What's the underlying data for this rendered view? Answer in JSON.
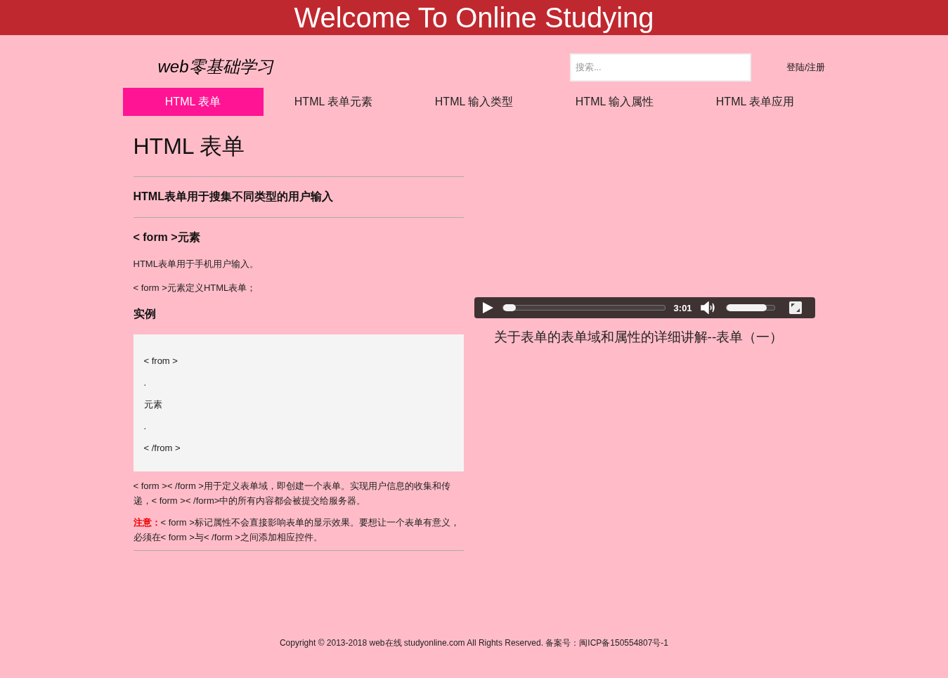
{
  "banner": {
    "title": "Welcome To Online Studying"
  },
  "header": {
    "logo": "web零基础学习",
    "search": {
      "placeholder": "搜索..."
    },
    "login": "登陆/注册"
  },
  "tabs": [
    {
      "label": "HTML 表单",
      "selected": true
    },
    {
      "label": "HTML 表单元素",
      "selected": false
    },
    {
      "label": "HTML 输入类型",
      "selected": false
    },
    {
      "label": "HTML 输入属性",
      "selected": false
    },
    {
      "label": "HTML 表单应用",
      "selected": false
    }
  ],
  "article": {
    "title": "HTML 表单",
    "subtitle": "HTML表单用于搜集不同类型的用户输入",
    "section": "< form >元素",
    "paragraphs": [
      "HTML表单用于手机用户输入。",
      "< form >元素定义HTML表单；"
    ],
    "example_heading": "实例",
    "code_lines": [
      "< from >",
      ".",
      "元素",
      ".",
      "< /from >"
    ],
    "description": "< form >< /form >用于定义表单域，即创建一个表单。实现用户信息的收集和传递，< form >< /form>中的所有内容都会被提交给服务器。",
    "note": "**注意：**< form >标记属性不会直接影响表单的显示效果。要想让一个表单有意义，必须在< form >与< /form >之间添加相应控件。"
  },
  "video": {
    "progress": {
      "level": 0.04
    },
    "time": "3:01",
    "volume": {
      "level": 0.85
    },
    "caption": "关于表单的表单域和属性的详细讲解--表单（一）"
  },
  "footer": "Copyright © 2013-2018 web在线 studyonline.com All Rights Reserved. 备案号：闽ICP备150554807号-1"
}
